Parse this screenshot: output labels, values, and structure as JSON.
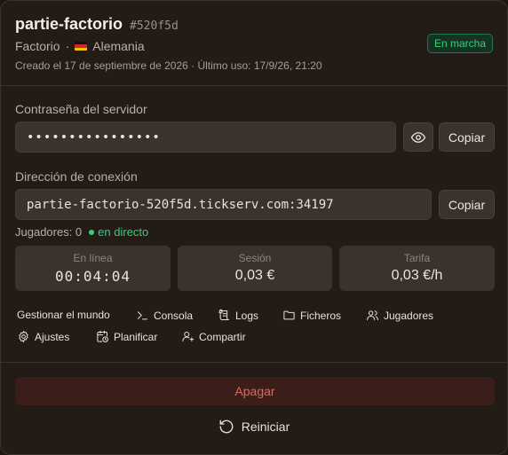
{
  "server": {
    "name": "partie-factorio",
    "id": "#520f5d",
    "game": "Factorio",
    "separator": "·",
    "country": "Alemania",
    "meta": "Creado el 17 de septiembre de 2026 · Último uso: 17/9/26, 21:20",
    "status": "En marcha"
  },
  "password": {
    "label": "Contraseña del servidor",
    "value": "••••••••••••••••",
    "copy_label": "Copiar"
  },
  "connection": {
    "label": "Dirección de conexión",
    "value": "partie-factorio-520f5d.tickserv.com:34197",
    "copy_label": "Copiar"
  },
  "players": {
    "text": "Jugadores: 0",
    "live": "en directo"
  },
  "stats": [
    {
      "label": "En línea",
      "value": "00:04:04"
    },
    {
      "label": "Sesión",
      "value": "0,03 €"
    },
    {
      "label": "Tarifa",
      "value": "0,03 €/h"
    }
  ],
  "actions": {
    "manage_world": "Gestionar el mundo",
    "console": "Consola",
    "logs": "Logs",
    "files": "Ficheros",
    "players": "Jugadores",
    "settings": "Ajustes",
    "schedule": "Planificar",
    "share": "Compartir"
  },
  "controls": {
    "stop": "Apagar",
    "restart": "Reiniciar"
  },
  "colors": {
    "accent_green": "#34d07a",
    "danger": "#e0685a",
    "background": "#221b16"
  }
}
